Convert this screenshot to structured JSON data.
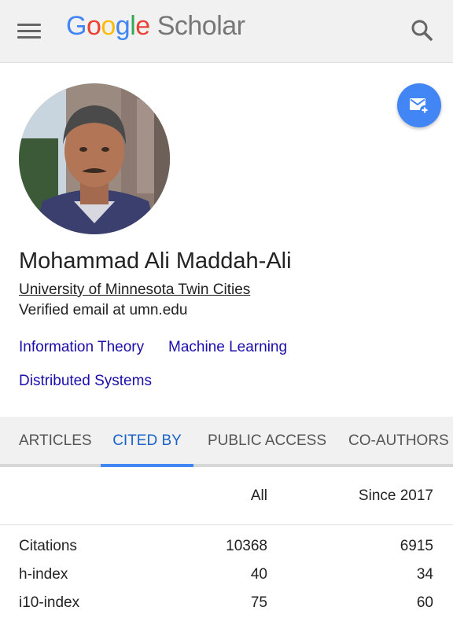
{
  "header": {
    "logo_google_letters": [
      "G",
      "o",
      "o",
      "g",
      "l",
      "e"
    ],
    "logo_colors": [
      "#4285f4",
      "#ea4335",
      "#fbbc05",
      "#4285f4",
      "#34a853",
      "#ea4335"
    ],
    "logo_scholar": "Scholar",
    "menu_icon": "hamburger-menu-icon",
    "search_icon": "search-icon"
  },
  "profile": {
    "name": "Mohammad Ali Maddah-Ali",
    "affiliation": "University of Minnesota Twin Cities",
    "email": "Verified email at umn.edu",
    "interests": [
      "Information Theory",
      "Machine Learning",
      "Distributed Systems"
    ],
    "follow_icon": "email-alert-icon",
    "accent_color": "#4285f4"
  },
  "tabs": [
    {
      "label": "ARTICLES",
      "active": false
    },
    {
      "label": "CITED BY",
      "active": true
    },
    {
      "label": "PUBLIC ACCESS",
      "active": false
    },
    {
      "label": "CO-AUTHORS",
      "active": false
    }
  ],
  "stats": {
    "headers": [
      "",
      "All",
      "Since 2017"
    ],
    "rows": [
      {
        "label": "Citations",
        "all": "10368",
        "since": "6915"
      },
      {
        "label": "h-index",
        "all": "40",
        "since": "34"
      },
      {
        "label": "i10-index",
        "all": "75",
        "since": "60"
      }
    ]
  },
  "colors": {
    "link": "#1a0dab",
    "active_tab": "#1a62c7",
    "bar_background": "#f1f1f1"
  }
}
